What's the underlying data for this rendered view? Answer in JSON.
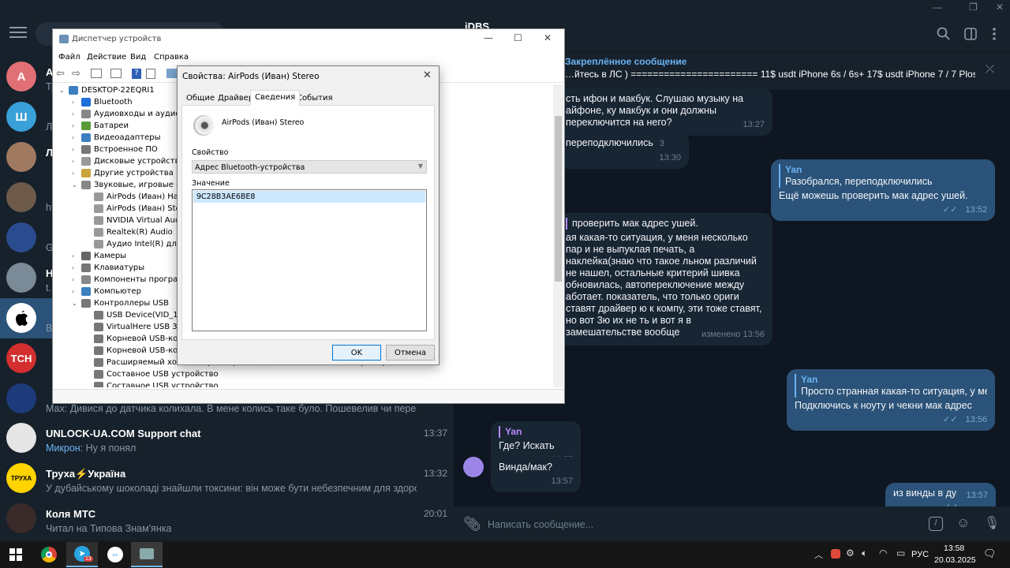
{
  "telegram": {
    "chat_name": "iDBS",
    "pinned": {
      "label": "Закреплённое сообщение",
      "text": "…йтесь в ЛС ) ======================= 11$ usdt  iPhone 6s / 6s+ 17$ usdt  iPhone 7 / 7 Plos 20$ ..."
    },
    "chats": [
      {
        "avatar": "А",
        "color": "#e17076",
        "title": "А",
        "preview": "Тр",
        "time": ""
      },
      {
        "avatar": "Ш",
        "color": "#3aa0d8",
        "title": "",
        "preview": "Ли",
        "time": ""
      },
      {
        "avatar": "",
        "color": "#a07a60",
        "title": "Л",
        "preview": "",
        "time": ""
      },
      {
        "avatar": "",
        "color": "#6d5a4a",
        "title": "",
        "preview": "ht",
        "time": ""
      },
      {
        "avatar": "",
        "color": "#2a4c8f",
        "title": "",
        "preview": "G",
        "time": ""
      },
      {
        "avatar": "",
        "color": "#7a8a96",
        "title": "Н",
        "preview": "t.",
        "time": ""
      },
      {
        "avatar": "",
        "color": "#ffffff",
        "title": "",
        "preview": "Ви",
        "time": ""
      },
      {
        "avatar": "TCH",
        "color": "#d32f2f",
        "title": "",
        "preview": "",
        "time": ""
      },
      {
        "avatar": "",
        "color": "#1d3b7a",
        "title": "",
        "preview": "Мах: Дивися до датчика колихала. В мене колись таке було. Пошевелив чи перевстановив дат...",
        "time": ""
      },
      {
        "avatar": "",
        "color": "#e6e6e6",
        "title": "UNLOCK-UA.COM Support chat",
        "preview_sender": "Микрон:",
        "preview": "Ну я понял",
        "time": "13:37"
      },
      {
        "avatar": "ТРУХА",
        "color": "#ffd400",
        "title": "Труха⚡Україна",
        "preview": "У дубайському шоколаді знайшли токсини: він може бути небезпечним для здоров'...",
        "time": "13:32"
      },
      {
        "avatar": "",
        "color": "#3a2a2a",
        "title": "Коля МТС",
        "preview": "Читал на Типова Знам'янка",
        "time": "20:01"
      }
    ],
    "messages": [
      {
        "type": "in",
        "text": "сть ифон и макбук. Слушаю музыку на айфоне, ку макбук и они должны переключится на него?",
        "time": "13:27"
      },
      {
        "type": "in",
        "text": "переподключились",
        "time": "13:30",
        "replies": "3"
      },
      {
        "type": "out",
        "reply_name": "Yan",
        "reply_text": "Разобрался, переподключились",
        "text": "Ещё можешь проверить мак адрес ушей.",
        "time": "13:52"
      },
      {
        "type": "in",
        "reply_text": "проверить мак адрес ушей.",
        "text": "ая какая-то ситуация, у меня несколько пар и не выпуклая печать, а наклейка(знаю что такое льном различий не нашел, остальные критерий шивка обновилась, автопереключение между аботает. показатель, что только ориги ставят драйвер ю к компу, эти тоже ставят, но вот 3ю их не ть и вот я в замешательстве вообще",
        "time": "изменено 13:56"
      },
      {
        "type": "out",
        "reply_name": "Yan",
        "reply_text": "Просто странная какая-то ситуация, у меня н...",
        "text": "Подключись к ноуту и чекни мак адрес",
        "time": "13:56"
      },
      {
        "type": "in",
        "reply_name": "Yan",
        "text": "Где? Искать",
        "time": "13:57"
      },
      {
        "type": "in",
        "text": "Винда/мак?",
        "time": "13:57"
      },
      {
        "type": "out",
        "text": "из винды в ду",
        "time": "13:57"
      }
    ],
    "composer_placeholder": "Написать сообщение..."
  },
  "device_manager": {
    "title": "Диспетчер устройств",
    "menu": [
      "Файл",
      "Действие",
      "Вид",
      "Справка"
    ],
    "tree": [
      {
        "level": 0,
        "label": "DESKTOP-22EQRI1",
        "exp": "v",
        "icon": "#3c7fc0"
      },
      {
        "level": 1,
        "label": "Bluetooth",
        "exp": ">",
        "icon": "#1e6fd9"
      },
      {
        "level": 1,
        "label": "Аудиовходы и аудиовыходы",
        "exp": ">",
        "icon": "#888"
      },
      {
        "level": 1,
        "label": "Батареи",
        "exp": ">",
        "icon": "#5a9b3a"
      },
      {
        "level": 1,
        "label": "Видеоадаптеры",
        "exp": ">",
        "icon": "#3c7fc0"
      },
      {
        "level": 1,
        "label": "Встроенное ПО",
        "exp": ">",
        "icon": "#777"
      },
      {
        "level": 1,
        "label": "Дисковые устройства",
        "exp": ">",
        "icon": "#999"
      },
      {
        "level": 1,
        "label": "Другие устройства",
        "exp": ">",
        "icon": "#c9a43a"
      },
      {
        "level": 1,
        "label": "Звуковые, игровые и видеоустройства",
        "exp": "v",
        "icon": "#888"
      },
      {
        "level": 2,
        "label": "AirPods (Иван) Hands-Free",
        "exp": "",
        "icon": "#999"
      },
      {
        "level": 2,
        "label": "AirPods (Иван) Stereo",
        "exp": "",
        "icon": "#999"
      },
      {
        "level": 2,
        "label": "NVIDIA Virtual Audio Device",
        "exp": "",
        "icon": "#999"
      },
      {
        "level": 2,
        "label": "Realtek(R) Audio",
        "exp": "",
        "icon": "#999"
      },
      {
        "level": 2,
        "label": "Аудио Intel(R) для дисплеев",
        "exp": "",
        "icon": "#999"
      },
      {
        "level": 1,
        "label": "Камеры",
        "exp": ">",
        "icon": "#666"
      },
      {
        "level": 1,
        "label": "Клавиатуры",
        "exp": ">",
        "icon": "#777"
      },
      {
        "level": 1,
        "label": "Компоненты программного обеспечения",
        "exp": ">",
        "icon": "#888"
      },
      {
        "level": 1,
        "label": "Компьютер",
        "exp": ">",
        "icon": "#3c7fc0"
      },
      {
        "level": 1,
        "label": "Контроллеры USB",
        "exp": "v",
        "icon": "#777"
      },
      {
        "level": 2,
        "label": "USB Device(VID_1f3a&PID_efe8)",
        "exp": "",
        "icon": "#777"
      },
      {
        "level": 2,
        "label": "VirtualHere USB 3 eXtensible Host Controller",
        "exp": "",
        "icon": "#777"
      },
      {
        "level": 2,
        "label": "Корневой USB-концентратор",
        "exp": "",
        "icon": "#777"
      },
      {
        "level": 2,
        "label": "Корневой USB-концентратор (USB 3.0)",
        "exp": "",
        "icon": "#777"
      },
      {
        "level": 2,
        "label": "Расширяемый хост-контроллер Intel(R) USB 3.10 - 1.20 (Майкрософт)",
        "exp": "",
        "icon": "#777"
      },
      {
        "level": 2,
        "label": "Составное USB устройство",
        "exp": "",
        "icon": "#777"
      },
      {
        "level": 2,
        "label": "Составное USB устройство",
        "exp": "",
        "icon": "#777"
      }
    ]
  },
  "dialog": {
    "title": "Свойства: AirPods (Иван) Stereo",
    "tabs": [
      "Общие",
      "Драйвер",
      "Сведения",
      "События"
    ],
    "device_name": "AirPods (Иван) Stereo",
    "property_label": "Свойство",
    "property_value": "Адрес Bluetooth-устройства",
    "value_label": "Значение",
    "value": "9C28B3AE6BE8",
    "ok": "OK",
    "cancel": "Отмена"
  },
  "taskbar": {
    "lang": "РУС",
    "time": "13:58",
    "date": "20.03.2025",
    "tg_badge": "13"
  }
}
